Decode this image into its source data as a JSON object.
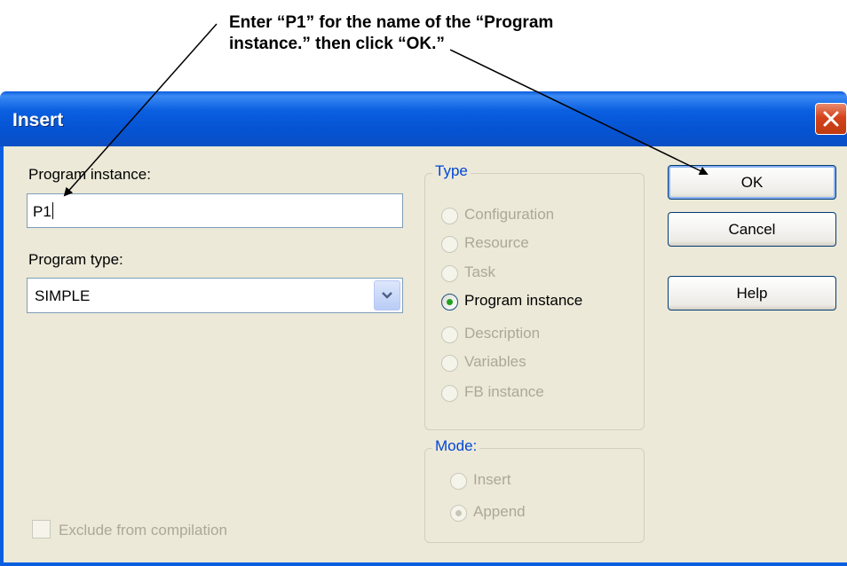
{
  "annotation": {
    "line1": "Enter “P1” for the name of the “Program",
    "line2": "instance.” then click “OK.”"
  },
  "dialog": {
    "title": "Insert",
    "program_instance_label": "Program instance:",
    "program_instance_value": "P1",
    "program_type_label": "Program type:",
    "program_type_value": "SIMPLE",
    "exclude_label": "Exclude from compilation"
  },
  "type_group": {
    "title": "Type",
    "options": [
      {
        "label": "Configuration",
        "enabled": false,
        "checked": false
      },
      {
        "label": "Resource",
        "enabled": false,
        "checked": false
      },
      {
        "label": "Task",
        "enabled": false,
        "checked": false
      },
      {
        "label": "Program instance",
        "enabled": true,
        "checked": true
      },
      {
        "label": "Description",
        "enabled": false,
        "checked": false
      },
      {
        "label": "Variables",
        "enabled": false,
        "checked": false
      },
      {
        "label": "FB instance",
        "enabled": false,
        "checked": false
      }
    ]
  },
  "mode_group": {
    "title": "Mode:",
    "options": [
      {
        "label": "Insert",
        "enabled": false,
        "checked": false
      },
      {
        "label": "Append",
        "enabled": false,
        "checked": true
      }
    ]
  },
  "buttons": {
    "ok": "OK",
    "cancel": "Cancel",
    "help": "Help"
  },
  "colors": {
    "titlebar": "#0a5fe0",
    "dialog_bg": "#ece9d8",
    "close": "#d4431b",
    "group_title": "#0046d5",
    "disabled_text": "#aca899"
  }
}
